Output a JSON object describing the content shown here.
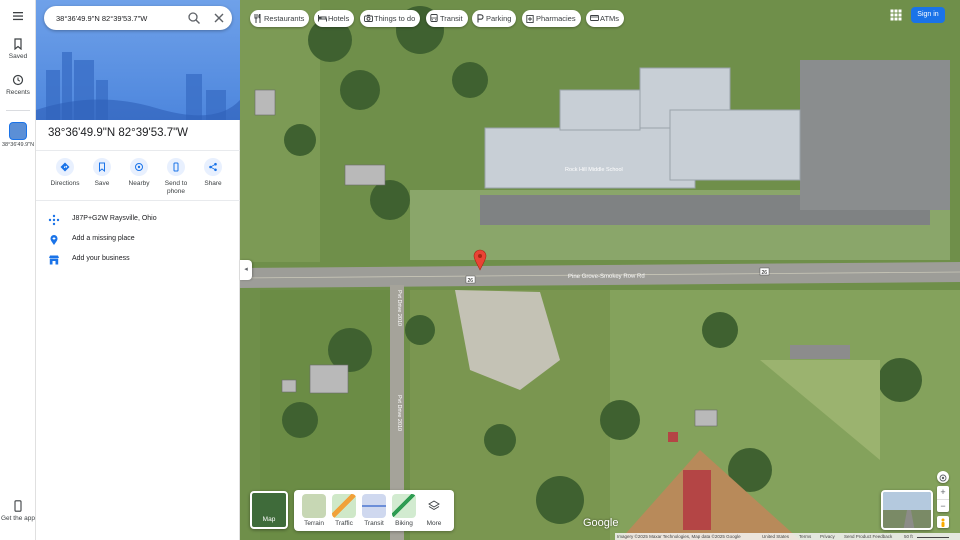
{
  "search": {
    "value": "38°36'49.9\"N 82°39'53.7\"W"
  },
  "rail": {
    "menu_icon": "hamburger-menu-icon",
    "saved_label": "Saved",
    "recents_label": "Recents",
    "recent_place_label": "38°36'49.9\"N",
    "get_app_label": "Get the app"
  },
  "place": {
    "title": "38°36'49.9\"N 82°39'53.7\"W",
    "actions": [
      {
        "label": "Directions",
        "icon": "directions-icon"
      },
      {
        "label": "Save",
        "icon": "bookmark-icon"
      },
      {
        "label": "Nearby",
        "icon": "nearby-icon"
      },
      {
        "label": "Send to phone",
        "icon": "phone-icon"
      },
      {
        "label": "Share",
        "icon": "share-icon"
      }
    ],
    "rows": [
      {
        "text": "J87P+G2W Raysville, Ohio",
        "icon": "plus-code-icon"
      },
      {
        "text": "Add a missing place",
        "icon": "add-place-icon"
      },
      {
        "text": "Add your business",
        "icon": "business-icon"
      }
    ]
  },
  "chips": [
    {
      "label": "Restaurants",
      "icon": "restaurant-icon"
    },
    {
      "label": "Hotels",
      "icon": "hotel-icon"
    },
    {
      "label": "Things to do",
      "icon": "camera-icon"
    },
    {
      "label": "Transit",
      "icon": "transit-icon"
    },
    {
      "label": "Parking",
      "icon": "parking-icon"
    },
    {
      "label": "Pharmacies",
      "icon": "pharmacy-icon"
    },
    {
      "label": "ATMs",
      "icon": "atm-icon"
    }
  ],
  "header": {
    "sign_in": "Sign in",
    "apps_icon": "apps-grid-icon"
  },
  "map_labels": {
    "school": "Rock Hill Middle School",
    "road": "Pine Grove-Smokey Row Rd",
    "route_shield_left": "26",
    "route_shield_right": "26",
    "side_road": "Pvt Drive 2010",
    "side_road_lower": "Pvt Drive 2010"
  },
  "layers": {
    "map_label": "Map",
    "options": [
      "Terrain",
      "Traffic",
      "Transit",
      "Biking",
      "More"
    ]
  },
  "footer": {
    "imagery": "Imagery ©2025 Maxar Technologies, Map data ©2025 Google",
    "country": "United States",
    "terms": "Terms",
    "privacy": "Privacy",
    "feedback": "Send Product Feedback",
    "scale": "50 ft"
  },
  "logo": "Google",
  "colors": {
    "accent": "#1a73e8",
    "pin": "#ea4335"
  }
}
